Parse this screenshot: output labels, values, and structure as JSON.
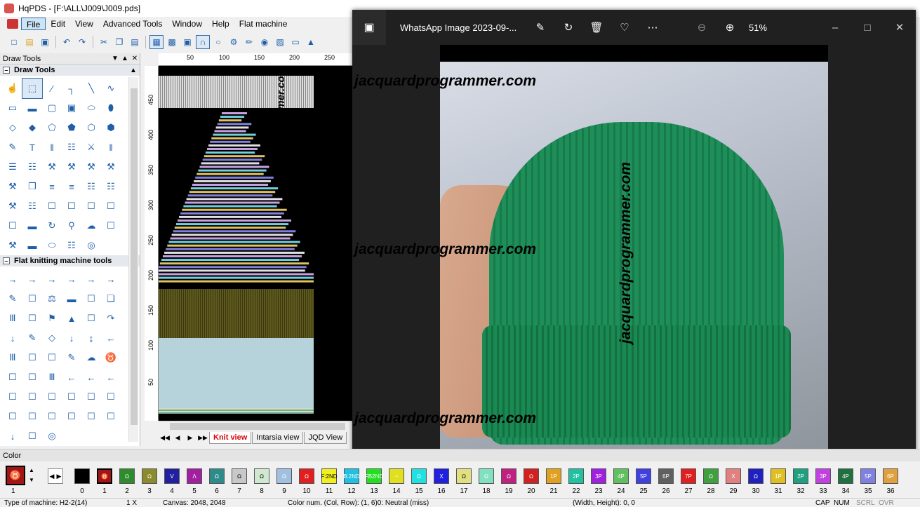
{
  "window": {
    "title": "HqPDS - [F:\\ALL\\J009\\J009.pds]"
  },
  "menu": [
    "File",
    "Edit",
    "View",
    "Advanced Tools",
    "Window",
    "Help",
    "Flat machine"
  ],
  "panel": {
    "title": "Draw Tools",
    "draw_section": "Draw Tools",
    "knit_section": "Flat knitting machine tools"
  },
  "ruler": {
    "top": [
      "50",
      "100",
      "150",
      "200",
      "250"
    ],
    "left": [
      "450",
      "400",
      "350",
      "300",
      "250",
      "200",
      "150",
      "100",
      "50"
    ]
  },
  "tabs": [
    "Knit view",
    "Intarsia view",
    "JQD View"
  ],
  "watermark": "jacquardprogrammer.com",
  "viewer": {
    "title": "WhatsApp Image 2023-09-...",
    "zoom": "51%"
  },
  "color_bar": {
    "label": "Color",
    "current_number": "1",
    "swatches": [
      {
        "n": "0",
        "c": "#000000",
        "t": ""
      },
      {
        "n": "1",
        "c": "#a01515",
        "t": "♉"
      },
      {
        "n": "2",
        "c": "#2e8b2e",
        "t": "Ω"
      },
      {
        "n": "3",
        "c": "#8b8b2e",
        "t": "Ω"
      },
      {
        "n": "4",
        "c": "#2020a0",
        "t": "V"
      },
      {
        "n": "5",
        "c": "#a020a0",
        "t": "Λ"
      },
      {
        "n": "6",
        "c": "#2e8b8b",
        "t": "Ω"
      },
      {
        "n": "7",
        "c": "#c8c8c8",
        "t": "Ω"
      },
      {
        "n": "8",
        "c": "#d0e8d0",
        "t": "Ω"
      },
      {
        "n": "9",
        "c": "#a0c0e0",
        "t": "Ω"
      },
      {
        "n": "10",
        "c": "#e02020",
        "t": "Ω"
      },
      {
        "n": "11",
        "c": "#f0f020",
        "t": "F:2ND"
      },
      {
        "n": "12",
        "c": "#20c0e0",
        "t": "B:2ND"
      },
      {
        "n": "13",
        "c": "#20e020",
        "t": "FB2ND"
      },
      {
        "n": "14",
        "c": "#e0e020",
        "t": "~"
      },
      {
        "n": "15",
        "c": "#20e0e0",
        "t": "Ω"
      },
      {
        "n": "16",
        "c": "#2020e0",
        "t": "X"
      },
      {
        "n": "17",
        "c": "#e0e080",
        "t": "Ω"
      },
      {
        "n": "18",
        "c": "#80e0c0",
        "t": "Ω"
      },
      {
        "n": "19",
        "c": "#c02080",
        "t": "Ω"
      },
      {
        "n": "20",
        "c": "#d02020",
        "t": "Ω"
      },
      {
        "n": "21",
        "c": "#e0a020",
        "t": "1P"
      },
      {
        "n": "22",
        "c": "#20c0a0",
        "t": "2P"
      },
      {
        "n": "23",
        "c": "#a020e0",
        "t": "3P"
      },
      {
        "n": "24",
        "c": "#60c060",
        "t": "4P"
      },
      {
        "n": "25",
        "c": "#4040e0",
        "t": "5P"
      },
      {
        "n": "26",
        "c": "#606060",
        "t": "6P"
      },
      {
        "n": "27",
        "c": "#e02020",
        "t": "7P"
      },
      {
        "n": "28",
        "c": "#40a040",
        "t": "Ω"
      },
      {
        "n": "29",
        "c": "#e08080",
        "t": "X"
      },
      {
        "n": "30",
        "c": "#2020c0",
        "t": "Ω"
      },
      {
        "n": "31",
        "c": "#e0c020",
        "t": "1P"
      },
      {
        "n": "32",
        "c": "#20a080",
        "t": "2P"
      },
      {
        "n": "33",
        "c": "#c040e0",
        "t": "3P"
      },
      {
        "n": "34",
        "c": "#207040",
        "t": "4P"
      },
      {
        "n": "35",
        "c": "#8080e0",
        "t": "5P"
      },
      {
        "n": "36",
        "c": "#e0a040",
        "t": "6P"
      }
    ]
  },
  "status": {
    "machine": "Type of machine: H2-2(14)",
    "zoom": "1 X",
    "canvas": "Canvas: 2048, 2048",
    "colornum": "Color num. (Col, Row): (1, 6)0: Neutral (miss)",
    "size": "(Width, Height): 0, 0",
    "cap": "CAP",
    "num": "NUM",
    "scrl": "SCRL",
    "ovr": "OVR"
  }
}
